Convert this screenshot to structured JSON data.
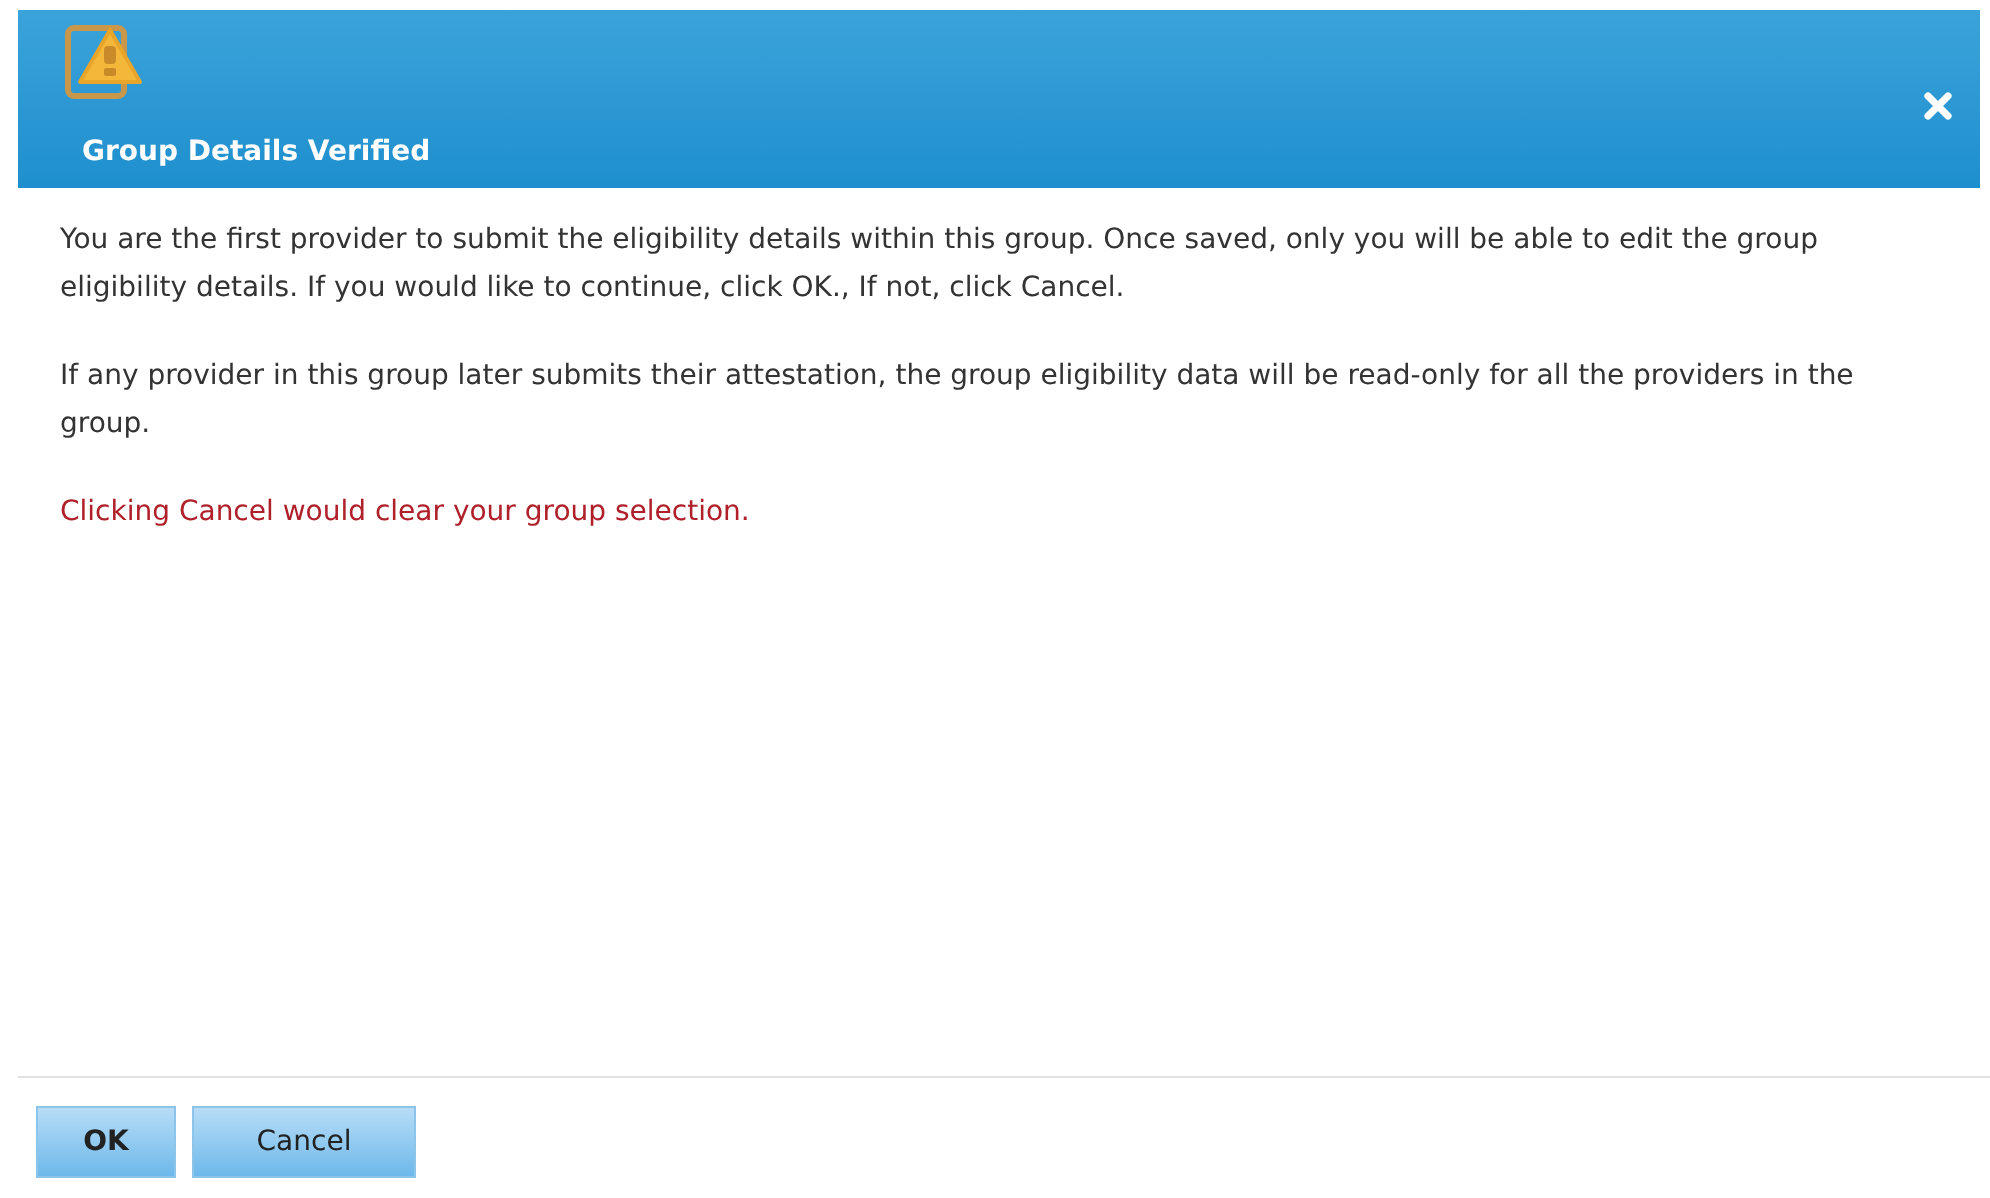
{
  "dialog": {
    "title": "Group Details Verified"
  },
  "paragraphs": [
    {
      "kind": "normal",
      "text": "You are the first provider to submit the eligibility details within this group. Once saved, only you will be able to edit the group eligibility details. If you would like to continue, click OK., If not, click Cancel."
    },
    {
      "kind": "normal",
      "text": "If any provider in this group later submits their attestation, the group eligibility data will be read-only for all the providers in the group."
    },
    {
      "kind": "warning",
      "text": "Clicking Cancel would clear your group selection."
    }
  ],
  "buttons": [
    "OK",
    "Cancel"
  ]
}
